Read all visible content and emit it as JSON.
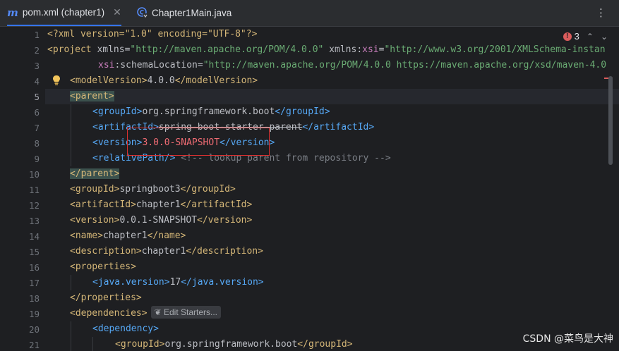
{
  "tabs": [
    {
      "label": "pom.xml (chapter1)",
      "icon": "maven-icon",
      "active": true
    },
    {
      "label": "Chapter1Main.java",
      "icon": "java-class-icon",
      "active": false
    }
  ],
  "inspections": {
    "error_count": "3"
  },
  "gutter": {
    "line_numbers": [
      "1",
      "2",
      "3",
      "4",
      "5",
      "6",
      "7",
      "8",
      "9",
      "10",
      "11",
      "12",
      "13",
      "14",
      "15",
      "16",
      "17",
      "18",
      "19",
      "20",
      "21"
    ],
    "current_line": "5"
  },
  "code": {
    "l1": {
      "a": "<?xml version=\"1.0\" encoding=\"UTF-8\"?>"
    },
    "l2": {
      "open": "<project",
      "attr1": " xmlns=",
      "val1": "\"http://maven.apache.org/POM/4.0.0\"",
      "attr2": " xmlns:",
      "ns": "xsi",
      "eq": "=",
      "val2": "\"http://www.w3.org/2001/XMLSchema-instan"
    },
    "l3": {
      "ns": "xsi",
      "attr": ":schemaLocation=",
      "val": "\"http://maven.apache.org/POM/4.0.0 https://maven.apache.org/xsd/maven-4.0"
    },
    "l4": {
      "o": "<modelVersion>",
      "t": "4.0.0",
      "c": "</modelVersion>"
    },
    "l5": {
      "o": "<parent>"
    },
    "l6": {
      "o": "<groupId>",
      "t": "org.springframework.boot",
      "c": "</groupId>"
    },
    "l7": {
      "o": "<artifactId>",
      "t": "spring-boot-starter-parent",
      "c": "</artifactId>"
    },
    "l8": {
      "o": "<version>",
      "t": "3.0.0-SNAPSHOT",
      "c": "</version>"
    },
    "l9": {
      "o": "<relativePath/>",
      "cm": " <!-- lookup parent from repository -->"
    },
    "l10": {
      "c": "</parent>"
    },
    "l11": {
      "o": "<groupId>",
      "t": "springboot3",
      "c": "</groupId>"
    },
    "l12": {
      "o": "<artifactId>",
      "t": "chapter1",
      "c": "</artifactId>"
    },
    "l13": {
      "o": "<version>",
      "t": "0.0.1-SNAPSHOT",
      "c": "</version>"
    },
    "l14": {
      "o": "<name>",
      "t": "chapter1",
      "c": "</name>"
    },
    "l15": {
      "o": "<description>",
      "t": "chapter1",
      "c": "</description>"
    },
    "l16": {
      "o": "<properties>"
    },
    "l17": {
      "o": "<java.version>",
      "t": "17",
      "c": "</java.version>"
    },
    "l18": {
      "c": "</properties>"
    },
    "l19": {
      "o": "<dependencies>",
      "inlay": "Edit Starters..."
    },
    "l20": {
      "o": "<dependency>"
    },
    "l21": {
      "o": "<groupId>",
      "t": "org.springframework.boot",
      "c": "</groupId>"
    }
  },
  "watermark": "CSDN @菜鸟是大神"
}
